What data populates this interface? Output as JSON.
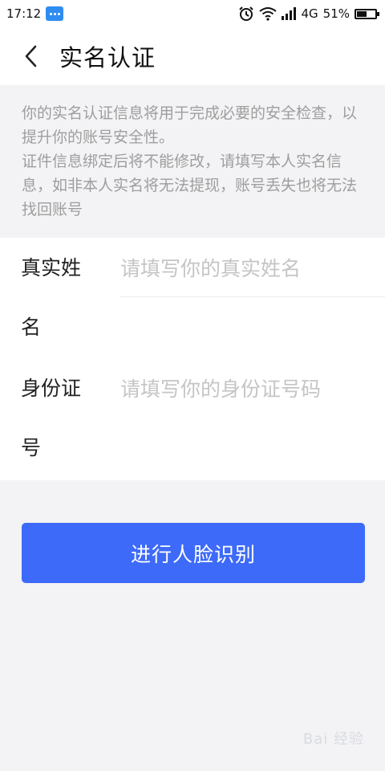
{
  "status_bar": {
    "time": "17:12",
    "network": "4G",
    "battery": "51%",
    "battery_level": 0.51,
    "icons": [
      "message-icon",
      "alarm-icon",
      "wifi-icon",
      "signal-icon",
      "battery-icon"
    ]
  },
  "header": {
    "back_icon": "chevron-left-icon",
    "title": "实名认证"
  },
  "notice": {
    "line1": "你的实名认证信息将用于完成必要的安全检查，以提升你的账号安全性。",
    "line2": "证件信息绑定后将不能修改，请填写本人实名信息，如非本人实名将无法提现，账号丢失也将无法找回账号"
  },
  "form": {
    "name_label_1": "真实姓",
    "name_label_2": "名",
    "name_placeholder": "请填写你的真实姓名",
    "name_value": "",
    "id_label_1": "身份证",
    "id_label_2": "号",
    "id_placeholder": "请填写你的身份证号码",
    "id_value": ""
  },
  "action": {
    "button_label": "进行人脸识别"
  },
  "colors": {
    "primary": "#3d6af8",
    "placeholder": "#c5c5c7",
    "notice_text": "#9e9e9e",
    "background": "#f3f3f5"
  }
}
